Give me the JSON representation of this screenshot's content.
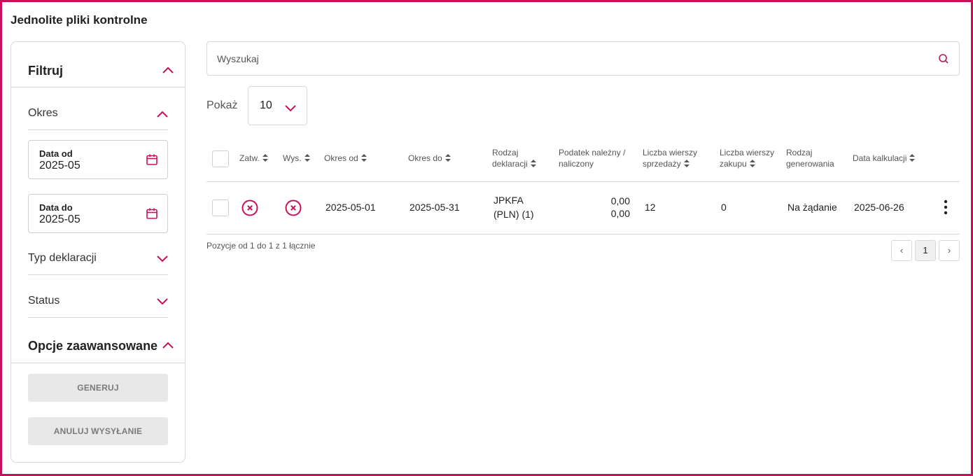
{
  "page": {
    "title": "Jednolite pliki kontrolne"
  },
  "colors": {
    "accent": "#c8105a",
    "border": "#d9d9d9",
    "disabled_bg": "#e8e8e8"
  },
  "sidebar": {
    "filter_title": "Filtruj",
    "period_label": "Okres",
    "date_from": {
      "label": "Data od",
      "value": "2025-05"
    },
    "date_to": {
      "label": "Data do",
      "value": "2025-05"
    },
    "decl_type_label": "Typ deklaracji",
    "status_label": "Status",
    "advanced_title": "Opcje zaawansowane",
    "generate_label": "GENERUJ",
    "cancel_send_label": "ANULUJ WYSYŁANIE"
  },
  "search": {
    "placeholder": "Wyszukaj"
  },
  "page_size": {
    "label": "Pokaż",
    "value": "10"
  },
  "table": {
    "headers": {
      "approved": "Zatw.",
      "sent": "Wys.",
      "period_from": "Okres od",
      "period_to": "Okres do",
      "decl_type_l1": "Rodzaj",
      "decl_type_l2": "deklaracji",
      "tax_l1": "Podatek należny /",
      "tax_l2": "naliczony",
      "sales_rows_l1": "Liczba wierszy",
      "sales_rows_l2": "sprzedaży",
      "purchase_rows_l1": "Liczba wierszy",
      "purchase_rows_l2": "zakupu",
      "gen_type_l1": "Rodzaj",
      "gen_type_l2": "generowania",
      "calc_date": "Data kalkulacji"
    },
    "rows": [
      {
        "approved_icon": "x-circle-icon",
        "sent_icon": "x-circle-icon",
        "period_from": "2025-05-01",
        "period_to": "2025-05-31",
        "decl_type_l1": "JPKFA",
        "decl_type_l2": "(PLN) (1)",
        "tax_due": "0,00",
        "tax_input": "0,00",
        "sales_rows": "12",
        "purchase_rows": "0",
        "gen_type": "Na żądanie",
        "calc_date": "2025-06-26"
      }
    ]
  },
  "footer": {
    "positions_info": "Pozycje od 1 do 1 z 1 łącznie",
    "prev": "‹",
    "current_page": "1",
    "next": "›"
  }
}
